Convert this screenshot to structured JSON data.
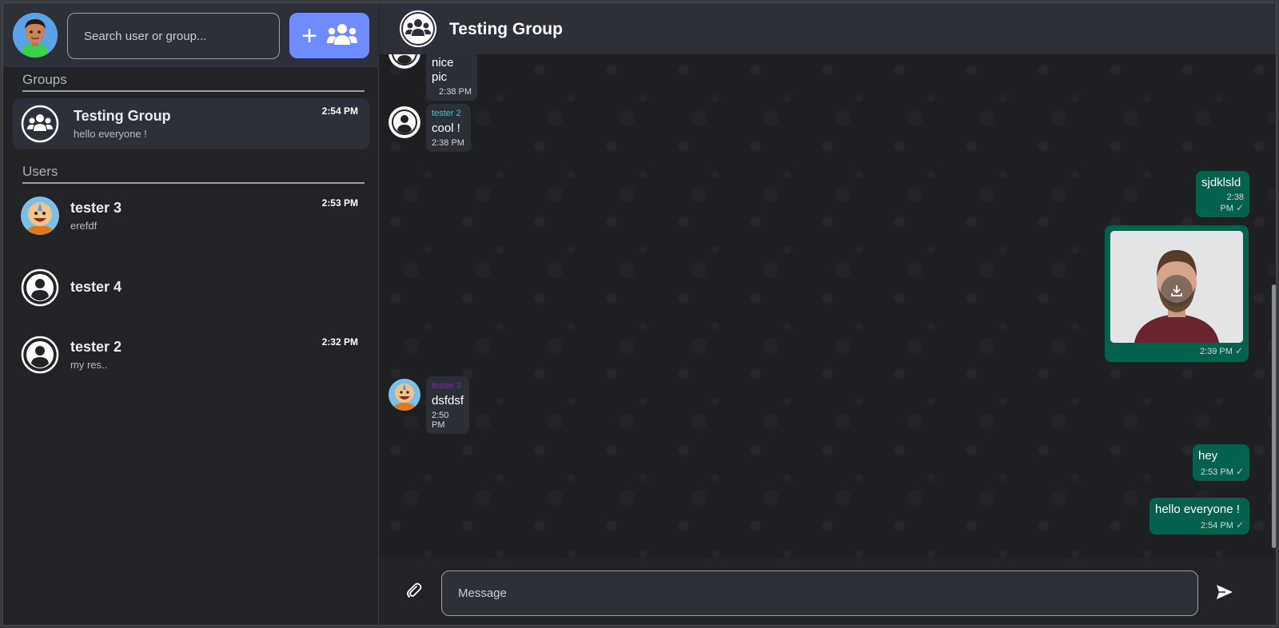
{
  "sidebar": {
    "search_placeholder": "Search user or group...",
    "groups_label": "Groups",
    "users_label": "Users",
    "groups": [
      {
        "name": "Testing Group",
        "last_message": "hello everyone !",
        "time": "2:54 PM",
        "active": true
      }
    ],
    "users": [
      {
        "name": "tester 3",
        "last_message": "erefdf",
        "time": "2:53 PM",
        "avatar": "cartoon-avatar"
      },
      {
        "name": "tester 4",
        "last_message": "",
        "time": "",
        "avatar": "default-user-icon"
      },
      {
        "name": "tester 2",
        "last_message": "my res..",
        "time": "2:32 PM",
        "avatar": "default-user-icon"
      }
    ]
  },
  "header": {
    "title": "Testing Group",
    "icon": "group-icon"
  },
  "messages": [
    {
      "direction": "in",
      "sender": "",
      "text": "nice pic",
      "time": "2:38 PM"
    },
    {
      "direction": "in",
      "sender": "tester 2",
      "sender_color": "#3fc9c9",
      "text": "cool !",
      "time": "2:38 PM"
    },
    {
      "direction": "out",
      "text": "sjdklsld",
      "time": "2:38 PM"
    },
    {
      "direction": "out",
      "type": "image",
      "time": "2:39 PM"
    },
    {
      "direction": "in",
      "sender": "tester 3",
      "sender_color": "#7b2fa8",
      "text": "dsfdsf",
      "time": "2:50 PM"
    },
    {
      "direction": "out",
      "text": "hey",
      "time": "2:53 PM"
    },
    {
      "direction": "out",
      "text": "hello everyone !",
      "time": "2:54 PM"
    }
  ],
  "composer": {
    "placeholder": "Message"
  },
  "colors": {
    "accent": "#6f8cff",
    "outgoing_bubble": "#04614d",
    "incoming_bubble": "#2b2f37",
    "header": "#2d3039"
  }
}
